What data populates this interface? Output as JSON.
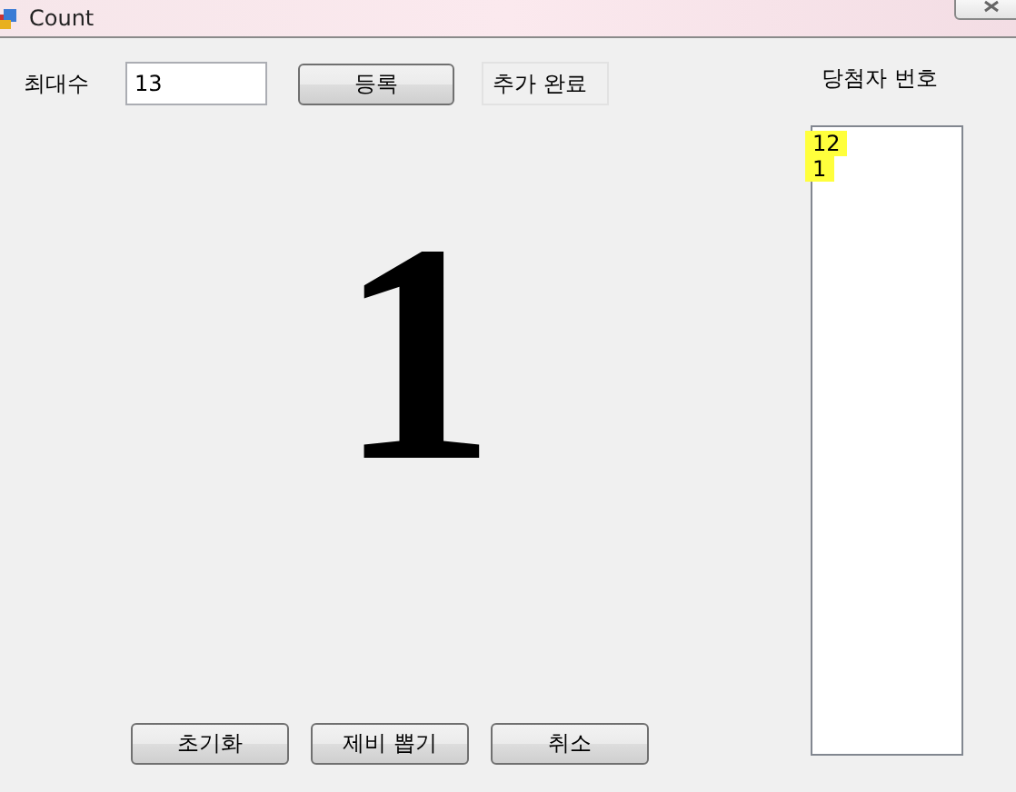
{
  "window": {
    "title": "Count"
  },
  "max_field": {
    "label": "최대수",
    "value": "13"
  },
  "register_button": "등록",
  "status": "추가 완료",
  "current_number": "1",
  "winners": {
    "title": "당첨자 번호",
    "items": [
      {
        "text": "12",
        "highlighted": true
      },
      {
        "text": "1",
        "highlighted": true
      }
    ]
  },
  "buttons": [
    "초기화",
    "제비 뽑기",
    "취소"
  ]
}
